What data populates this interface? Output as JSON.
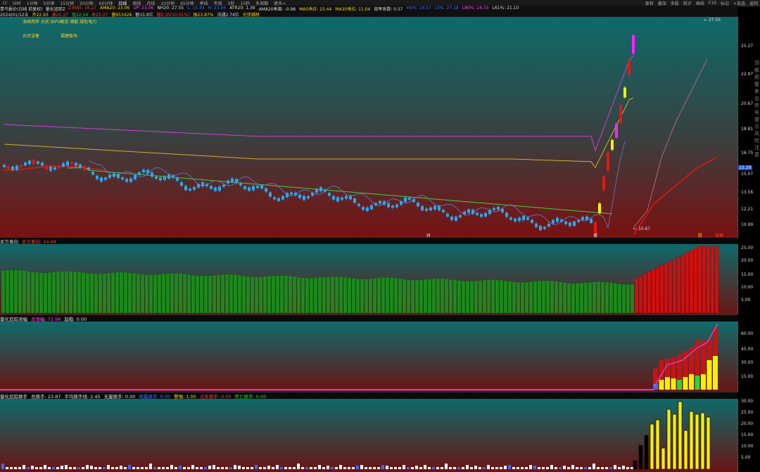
{
  "topbar": {
    "tabs": [
      "Lt",
      "分时",
      "1分钟",
      "5分钟",
      "15分钟",
      "30分钟",
      "60分钟",
      "日线",
      "周线",
      "月线",
      "10分钟",
      "45分钟",
      "季线",
      "年线",
      "5秒",
      "15秒",
      "多周期",
      "更多>"
    ],
    "active_tab": "日线",
    "right_items": [
      "复权",
      "叠加",
      "多股",
      "统计",
      "画线",
      "F10",
      "标记",
      "+自选",
      "返回"
    ]
  },
  "info1": {
    "name": "青鸟报价(日线 前复权)",
    "indicator": "量化追踪Z",
    "items": [
      {
        "text": "Z-MA5: 16.27",
        "color": "#ff3a3a"
      },
      {
        "text": "AMA20: 23.06",
        "color": "#ffd21e"
      },
      {
        "text": "UP: 23.06",
        "color": "#ff44ff"
      },
      {
        "text": "NH20: 27.55",
        "color": "#dddddd"
      },
      {
        "text": "L: 15.44",
        "color": "#3a6cff"
      },
      {
        "text": "H: 23.06",
        "color": "#3a6cff"
      },
      {
        "text": "ATR20: 1.39",
        "color": "#dddddd"
      },
      {
        "text": "AMA20乖离: -0.98",
        "color": "#dddddd"
      },
      {
        "text": "MA5乖拉: 23.44",
        "color": "#ffd21e"
      },
      {
        "text": "MA30乖拉: 11.04",
        "color": "#ffd21e"
      },
      {
        "text": "效率系数: 0.57",
        "color": "#dddddd"
      },
      {
        "text": "H5%: 16.57",
        "color": "#3a6cff"
      },
      {
        "text": "L5%: 27.18",
        "color": "#3a6cff"
      },
      {
        "text": "L80%: 24.33",
        "color": "#ff44ff"
      },
      {
        "text": "L61%: 21.10",
        "color": "#dddddd"
      }
    ]
  },
  "info2": {
    "items": [
      {
        "text": "2024/01/12五",
        "color": "#dddddd"
      },
      {
        "text": "开22.93",
        "color": "#ffd21e"
      },
      {
        "text": "高25.27",
        "color": "#ff3a3a"
      },
      {
        "text": "低22.54",
        "color": "#2fd42f"
      },
      {
        "text": "收25.27",
        "color": "#ff3a3a"
      },
      {
        "text": "量653428",
        "color": "#ffd21e"
      },
      {
        "text": "额15.9亿",
        "color": "#dddddd"
      },
      {
        "text": "幅2.30(10.01%)",
        "color": "#ff3a3a"
      },
      {
        "text": "振23.87%",
        "color": "#ffd21e"
      },
      {
        "text": "流通2.74亿",
        "color": "#dddddd"
      },
      {
        "text": "光伏辅材",
        "color": "#ffd21e"
      }
    ]
  },
  "main": {
    "concepts": [
      "海峡西岸 光伏 BIPV概念 储能 绿色电力",
      "光伏设备",
      "福建板块"
    ],
    "axis_labels": [
      "25.27",
      "22.97",
      "20.67",
      "18.81",
      "16.75",
      "15.07",
      "13.56",
      "12.21",
      "10.99"
    ],
    "current_price_tag": "15.29",
    "high_label": "27.55",
    "low_label": "10.67",
    "markers": [
      "财",
      "增",
      "跌",
      "涨幅"
    ]
  },
  "panel1": {
    "title": "买方意向",
    "value_label": "买方意向: 24.68",
    "axis_labels": [
      "25.00",
      "20.00",
      "15.00",
      "10.00",
      "5.00"
    ]
  },
  "panel2": {
    "title": "量化追踪涨幅",
    "value_label": "总涨幅: 71.96",
    "extra": "起稳: 0.00",
    "axis_labels": [
      "60.00",
      "45.00",
      "30.00",
      "15.00"
    ]
  },
  "panel3": {
    "title": "量化追踪换手",
    "items": [
      {
        "text": "总换手: 23.87",
        "color": "#dddddd"
      },
      {
        "text": "平均换手线: 2.45",
        "color": "#dddddd"
      },
      {
        "text": "无量换手: 0.00",
        "color": "#dddddd"
      },
      {
        "text": "缩量换手: 0.00",
        "color": "#3a6cff"
      },
      {
        "text": "警惕: 1.00",
        "color": "#ffd21e"
      },
      {
        "text": "过年换手: 0.00",
        "color": "#ff3a3a"
      },
      {
        "text": "死亡换手: 0.00",
        "color": "#2fd42f"
      }
    ],
    "axis_labels": [
      "30.00",
      "25.00",
      "20.00",
      "15.00",
      "10.00",
      "5.00"
    ]
  },
  "side_text": "顶部预警卖出信号提示风险注意"
}
